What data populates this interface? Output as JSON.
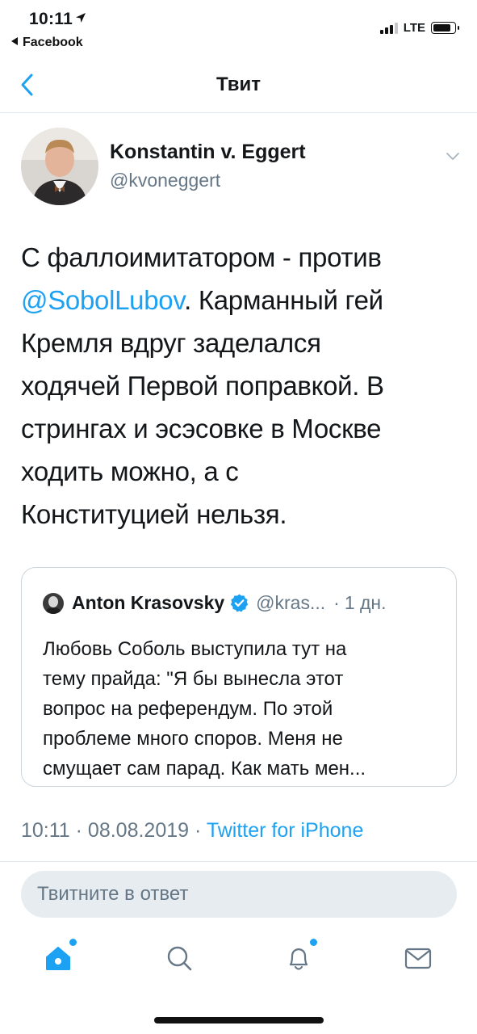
{
  "status_bar": {
    "time": "10:11",
    "back_app": "Facebook",
    "network": "LTE",
    "battery_level": 0.85,
    "signal_bars": 3
  },
  "nav": {
    "title": "Твит",
    "back_icon": "chevron-left-icon"
  },
  "tweet": {
    "author_name": "Konstantin v. Eggert",
    "author_handle": "@kvoneggert",
    "text_lines": [
      {
        "before": "С фаллоимитатором - против",
        "mention": "",
        "after": ""
      },
      {
        "before": "",
        "mention": "@SobolLubov",
        "after": ". Карманный гей"
      },
      {
        "before": "Кремля вдруг заделался",
        "mention": "",
        "after": ""
      },
      {
        "before": "ходячей Первой поправкой. В",
        "mention": "",
        "after": ""
      },
      {
        "before": "стрингах и эсэсовке в Москве",
        "mention": "",
        "after": ""
      },
      {
        "before": "ходить можно, а с",
        "mention": "",
        "after": ""
      },
      {
        "before": "Конституцией нельзя.",
        "mention": "",
        "after": ""
      }
    ],
    "timestamp": "10:11 · 08.08.2019 · ",
    "source": "Twitter for iPhone"
  },
  "quote": {
    "name": "Anton Krasovsky",
    "handle": "@kras...",
    "separator": "·",
    "time": "1 дн.",
    "text_lines": [
      "Любовь Соболь выступила тут на",
      "тему прайда: \"Я бы вынесла этот",
      "вопрос на референдум. По этой",
      "проблеме много споров. Меня не",
      "смущает сам парад. Как мать мен..."
    ]
  },
  "reply": {
    "placeholder": "Твитните в ответ"
  },
  "tabs": [
    {
      "name": "tab-home",
      "icon": "home-icon",
      "active": true,
      "badge": true
    },
    {
      "name": "tab-search",
      "icon": "search-icon",
      "active": false,
      "badge": false
    },
    {
      "name": "tab-notifications",
      "icon": "bell-icon",
      "active": false,
      "badge": true
    },
    {
      "name": "tab-messages",
      "icon": "mail-icon",
      "active": false,
      "badge": false
    }
  ],
  "colors": {
    "accent": "#1da1f2",
    "text": "#14171a",
    "secondary": "#657786",
    "border": "#e1e8ed"
  }
}
